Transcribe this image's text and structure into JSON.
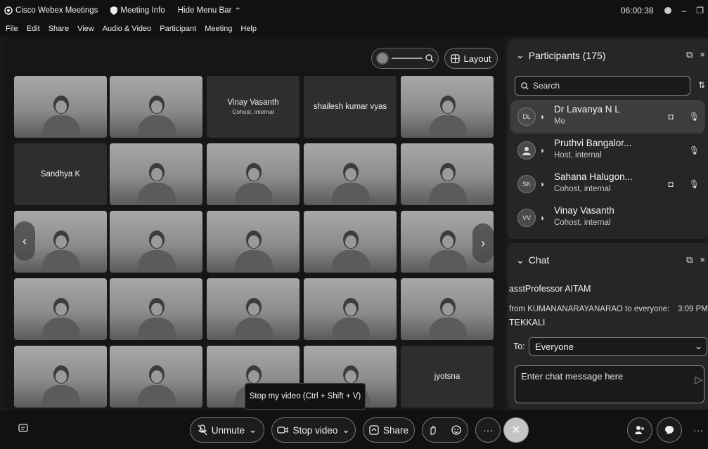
{
  "titlebar": {
    "app_title": "Cisco Webex Meetings",
    "meeting_info": "Meeting Info",
    "hide_menu": "Hide Menu Bar",
    "timer": "06:00:38"
  },
  "menu": [
    "File",
    "Edit",
    "Share",
    "View",
    "Audio & Video",
    "Participant",
    "Meeting",
    "Help"
  ],
  "stage": {
    "layout_label": "Layout",
    "tooltip": "Stop my video (Ctrl + Shift + V)"
  },
  "tiles": {
    "vinay": {
      "name": "Vinay Vasanth",
      "role": "Cohost, internal"
    },
    "shailesh": {
      "name": "shailesh kumar vyas"
    },
    "sandhya": {
      "name": "Sandhya K"
    },
    "jyotsna": {
      "name": "jyotsna"
    }
  },
  "controls": {
    "unmute": "Unmute",
    "stop_video": "Stop video",
    "share": "Share"
  },
  "participants": {
    "header": "Participants (175)",
    "search_placeholder": "Search",
    "list": [
      {
        "initials": "DL",
        "name": "Dr Lavanya N L",
        "role": "Me"
      },
      {
        "initials": "",
        "name": "Pruthvi Bangalor...",
        "role": "Host, internal"
      },
      {
        "initials": "SK",
        "name": "Sahana Halugon...",
        "role": "Cohost, internal"
      },
      {
        "initials": "VV",
        "name": "Vinay Vasanth",
        "role": "Cohost, internal"
      }
    ]
  },
  "chat": {
    "header": "Chat",
    "line1": "asstProfessor AITAM",
    "from_line": "from KUMANANARAYANARAO to everyone:",
    "time": "3:09 PM",
    "line2": "TEKKALI",
    "to_label": "To:",
    "to_value": "Everyone",
    "input_placeholder": "Enter chat message here"
  }
}
